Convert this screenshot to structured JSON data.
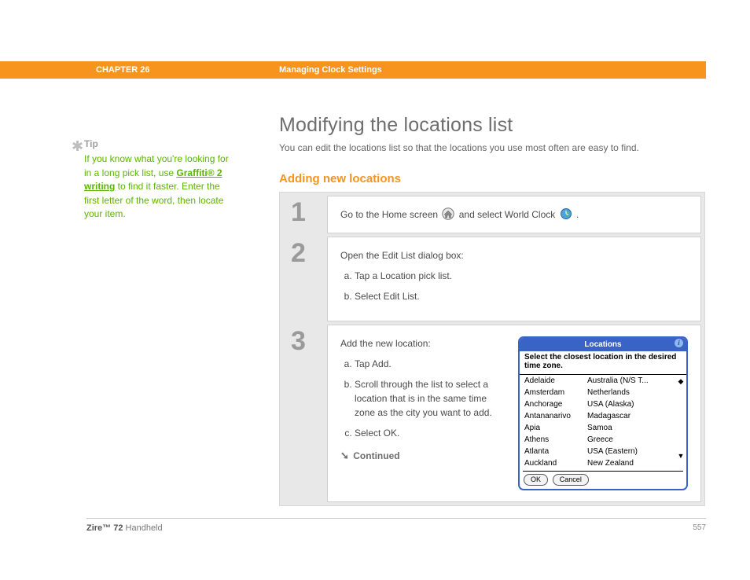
{
  "header": {
    "chapter": "CHAPTER 26",
    "section": "Managing Clock Settings"
  },
  "tip": {
    "label": "Tip",
    "pre": "If you know what you're looking for in a long pick list, use ",
    "link": "Graffiti® 2 writing",
    "post": " to find it faster. Enter the first letter of the word, then locate your item."
  },
  "main": {
    "h1": "Modifying the locations list",
    "intro": "You can edit the locations list so that the locations you use most often are easy to find.",
    "subhead": "Adding new locations"
  },
  "steps": {
    "s1": {
      "num": "1",
      "pre": "Go to the Home screen ",
      "mid": " and select World Clock ",
      "post": "."
    },
    "s2": {
      "num": "2",
      "lead": "Open the Edit List dialog box:",
      "a": "Tap a Location pick list.",
      "b": "Select Edit List."
    },
    "s3": {
      "num": "3",
      "lead": "Add the new location:",
      "a": "Tap Add.",
      "b": "Scroll through the list to select a location that is in the same time zone as the city you want to add.",
      "c": "Select OK.",
      "continued": "Continued"
    }
  },
  "dialog": {
    "title": "Locations",
    "instr": "Select the closest location in the desired time zone.",
    "rows": [
      {
        "city": "Adelaide",
        "region": "Australia (N/S T..."
      },
      {
        "city": "Amsterdam",
        "region": "Netherlands"
      },
      {
        "city": "Anchorage",
        "region": "USA (Alaska)"
      },
      {
        "city": "Antananarivo",
        "region": "Madagascar"
      },
      {
        "city": "Apia",
        "region": "Samoa"
      },
      {
        "city": "Athens",
        "region": "Greece"
      },
      {
        "city": "Atlanta",
        "region": "USA (Eastern)"
      },
      {
        "city": "Auckland",
        "region": "New Zealand"
      }
    ],
    "ok": "OK",
    "cancel": "Cancel"
  },
  "footer": {
    "product_bold": "Zire™ 72",
    "product_rest": " Handheld",
    "page": "557"
  }
}
